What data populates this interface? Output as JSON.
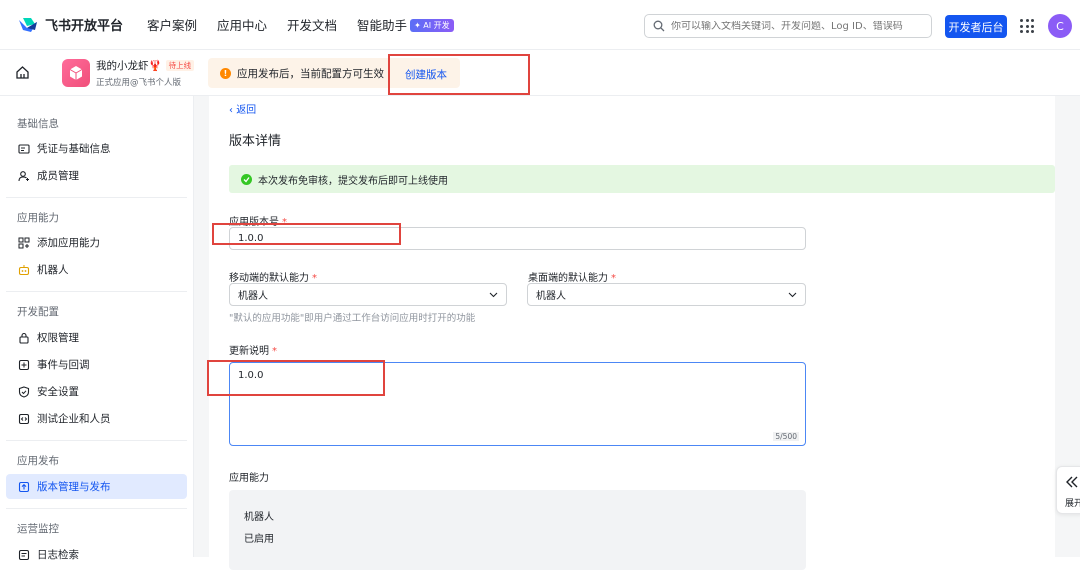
{
  "topbar": {
    "logo_text": "飞书开放平台",
    "nav": [
      {
        "label": "客户案例"
      },
      {
        "label": "应用中心"
      },
      {
        "label": "开发文档"
      },
      {
        "label": "智能助手"
      }
    ],
    "ai_badge": "✦ AI 开发",
    "search_placeholder": "你可以输入文档关键词、开发问题、Log ID、错误码",
    "dev_console_button": "开发者后台",
    "avatar_letter": "C"
  },
  "appbar": {
    "app_name": "我的小龙虾🦞",
    "app_status_badge": "待上线",
    "app_subtitle": "正式应用@飞书个人版",
    "notice_text": "应用发布后，当前配置方可生效",
    "create_version_link": "创建版本"
  },
  "sidebar": {
    "sections": [
      {
        "title": "基础信息",
        "items": [
          {
            "label": "凭证与基础信息",
            "icon": "id-card-icon"
          },
          {
            "label": "成员管理",
            "icon": "user-add-icon"
          }
        ]
      },
      {
        "title": "应用能力",
        "items": [
          {
            "label": "添加应用能力",
            "icon": "grid-add-icon"
          },
          {
            "label": "机器人",
            "icon": "robot-icon"
          }
        ]
      },
      {
        "title": "开发配置",
        "items": [
          {
            "label": "权限管理",
            "icon": "lock-icon"
          },
          {
            "label": "事件与回调",
            "icon": "event-icon"
          },
          {
            "label": "安全设置",
            "icon": "shield-icon"
          },
          {
            "label": "测试企业和人员",
            "icon": "code-icon"
          }
        ]
      },
      {
        "title": "应用发布",
        "items": [
          {
            "label": "版本管理与发布",
            "icon": "upload-icon",
            "active": true
          }
        ]
      },
      {
        "title": "运营监控",
        "items": [
          {
            "label": "日志检索",
            "icon": "log-icon"
          }
        ]
      }
    ]
  },
  "main": {
    "back_label": "返回",
    "page_title": "版本详情",
    "success_message": "本次发布免审核，提交发布后即可上线使用",
    "version_label": "应用版本号",
    "version_value": "1.0.0",
    "mobile_default_label": "移动端的默认能力",
    "mobile_default_value": "机器人",
    "desktop_default_label": "桌面端的默认能力",
    "desktop_default_value": "机器人",
    "default_hint": "\"默认的应用功能\"即用户通过工作台访问应用时打开的功能",
    "update_notes_label": "更新说明",
    "update_notes_value": "1.0.0",
    "update_notes_counter": "5/500",
    "capability_label": "应用能力",
    "capability_name": "机器人",
    "capability_status": "已启用",
    "required_mark": "*"
  },
  "expand_panel": {
    "label": "展开"
  },
  "colors": {
    "accent": "#1456f0",
    "success": "#34c724",
    "warning": "#ff8800",
    "highlight_box": "#e0443e"
  }
}
